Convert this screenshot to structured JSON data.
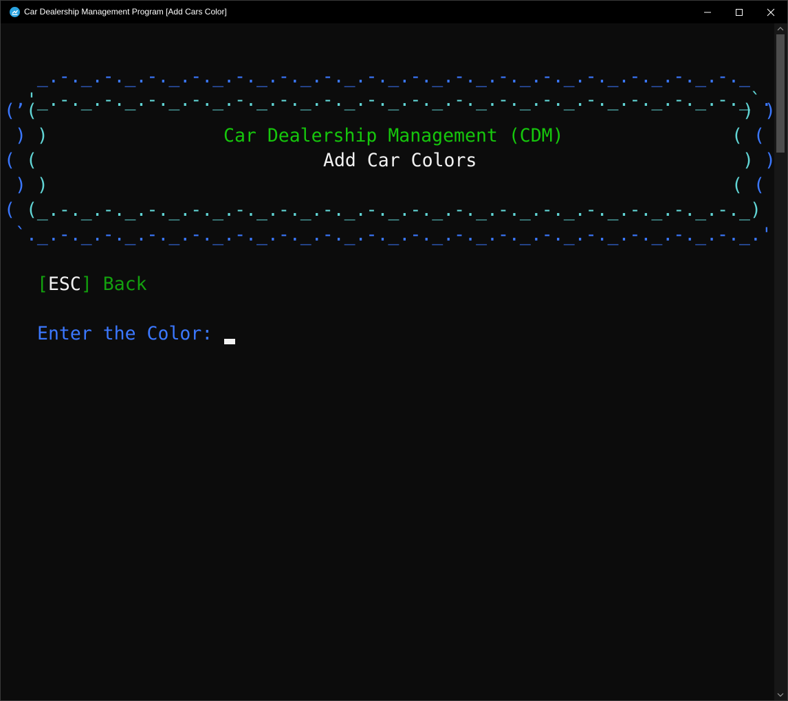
{
  "window": {
    "title": "Car Dealership Management Program [Add Cars Color]",
    "icons": {
      "app": "terminal-app-icon",
      "minimize": "minimize-icon",
      "maximize": "maximize-icon",
      "close": "close-icon"
    }
  },
  "banner": {
    "top_outer": "_.-._.-._.-._.-._.-._.-._.-._.-._.-._.-._.-._.-._.-._.-._.-._.-._",
    "top_inner": "'_.-._.-._.-._.-._.-._.-._.-._.-._.-._.-._.-._.-._.-._.-._.-._.-._`",
    "top_left_outer": ",",
    "top_right_outer": ".",
    "title": "Car Dealership Management (CDM)",
    "subtitle": "Add Car Colors",
    "bottom_inner": "_.-._.-._.-._.-._.-._.-._.-._.-._.-._.-._.-._.-._.-._.-._.-._.-._",
    "bottom_outer": "._.-._.-._.-._.-._.-._.-._.-._.-._.-._.-._.-._.-._.-._.-._.-._.-._.'",
    "bottom_left_outer": "`",
    "paren_open": "(",
    "paren_close": ")"
  },
  "menu": {
    "esc_open": "[",
    "esc_key": "ESC",
    "esc_close": "]",
    "back_label": "Back"
  },
  "prompt": {
    "label": "Enter the Color:",
    "value": ""
  },
  "colors": {
    "blue": "#3b78ff",
    "cyan": "#61d6d6",
    "green": "#16c60c",
    "dark_green": "#13a10e",
    "white": "#f2f2f2",
    "background": "#0c0c0c"
  }
}
